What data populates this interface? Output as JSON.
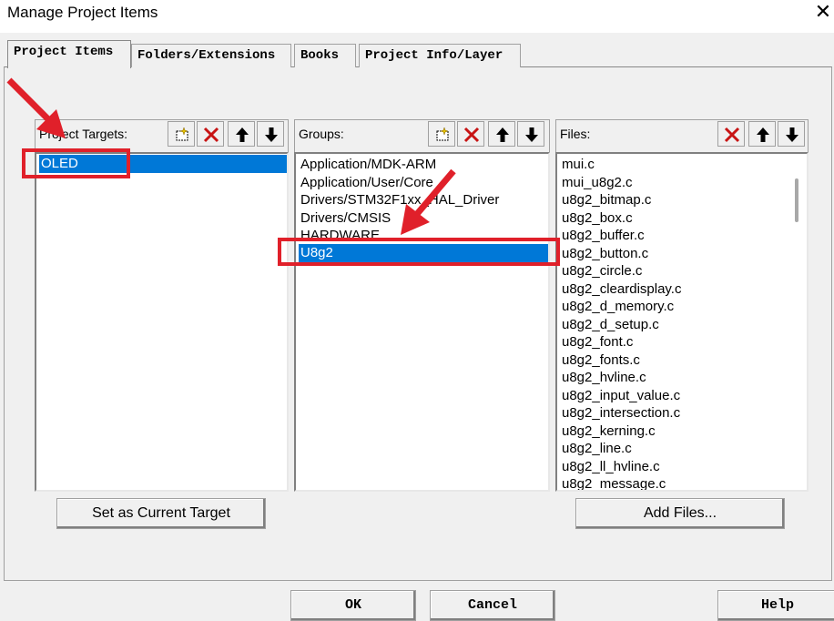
{
  "window": {
    "title": "Manage Project Items",
    "close_glyph": "✕"
  },
  "tabs": [
    {
      "label": "Project Items",
      "active": true
    },
    {
      "label": "Folders/Extensions",
      "active": false
    },
    {
      "label": "Books",
      "active": false
    },
    {
      "label": "Project Info/Layer",
      "active": false
    }
  ],
  "targets": {
    "label": "Project Targets:",
    "items": [
      "OLED"
    ],
    "selected": "OLED",
    "set_current_label": "Set as Current Target"
  },
  "groups": {
    "label": "Groups:",
    "items": [
      "Application/MDK-ARM",
      "Application/User/Core",
      "Drivers/STM32F1xx_HAL_Driver",
      "Drivers/CMSIS",
      "HARDWARE",
      "U8g2"
    ],
    "selected": "U8g2"
  },
  "files": {
    "label": "Files:",
    "items": [
      "mui.c",
      "mui_u8g2.c",
      "u8g2_bitmap.c",
      "u8g2_box.c",
      "u8g2_buffer.c",
      "u8g2_button.c",
      "u8g2_circle.c",
      "u8g2_cleardisplay.c",
      "u8g2_d_memory.c",
      "u8g2_d_setup.c",
      "u8g2_font.c",
      "u8g2_fonts.c",
      "u8g2_hvline.c",
      "u8g2_input_value.c",
      "u8g2_intersection.c",
      "u8g2_kerning.c",
      "u8g2_line.c",
      "u8g2_ll_hvline.c",
      "u8g2_message.c"
    ],
    "add_files_label": "Add Files..."
  },
  "footer": {
    "ok": "OK",
    "cancel": "Cancel",
    "help": "Help"
  },
  "colors": {
    "selection": "#0078d7",
    "annotation": "#e0202a"
  },
  "icons": [
    "new-item-icon",
    "delete-icon",
    "move-up-icon",
    "move-down-icon"
  ]
}
